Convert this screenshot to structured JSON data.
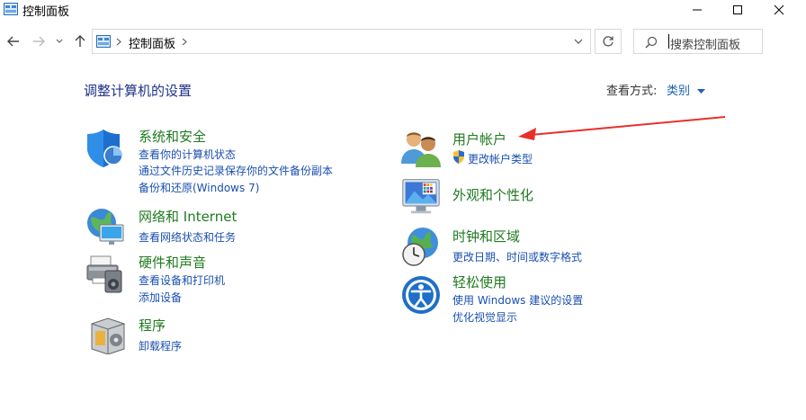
{
  "window": {
    "title": "控制面板"
  },
  "address": {
    "crumb": "控制面板"
  },
  "search": {
    "placeholder": "搜索控制面板"
  },
  "main": {
    "heading": "调整计算机的设置",
    "view_by_label": "查看方式:",
    "view_by_value": "类别"
  },
  "categories": {
    "system": {
      "title": "系统和安全",
      "links": [
        "查看你的计算机状态",
        "通过文件历史记录保存你的文件备份副本",
        "备份和还原(Windows 7)"
      ]
    },
    "network": {
      "title": "网络和 Internet",
      "links": [
        "查看网络状态和任务"
      ]
    },
    "hardware": {
      "title": "硬件和声音",
      "links": [
        "查看设备和打印机",
        "添加设备"
      ]
    },
    "programs": {
      "title": "程序",
      "links": [
        "卸载程序"
      ]
    },
    "users": {
      "title": "用户帐户",
      "links": [
        "更改帐户类型"
      ]
    },
    "appearance": {
      "title": "外观和个性化",
      "links": []
    },
    "clock": {
      "title": "时钟和区域",
      "links": [
        "更改日期、时间或数字格式"
      ]
    },
    "ease": {
      "title": "轻松使用",
      "links": [
        "使用 Windows 建议的设置",
        "优化视觉显示"
      ]
    }
  },
  "colors": {
    "heading": "#1e3287",
    "category_title": "#1f7a1f",
    "link": "#1a4fb0",
    "annotation_arrow": "#e8302a"
  }
}
